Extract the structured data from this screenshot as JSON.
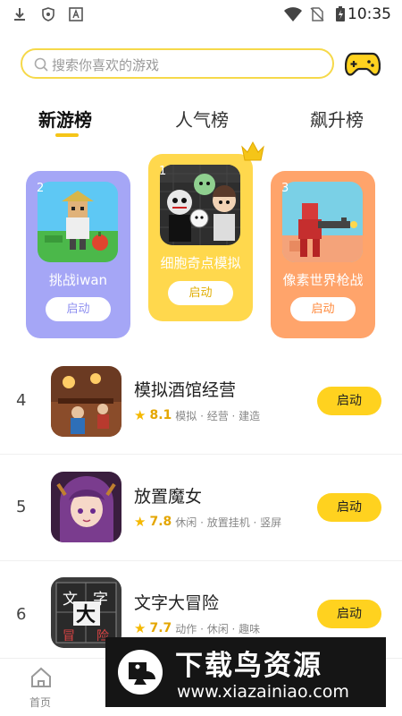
{
  "status_bar": {
    "time": "10:35",
    "icons": [
      "download-icon",
      "shield-icon",
      "text-a-icon",
      "wifi-icon",
      "no-sim-icon",
      "battery-charging-icon"
    ]
  },
  "search": {
    "placeholder": "搜索你喜欢的游戏"
  },
  "tabs": [
    {
      "label": "新游榜",
      "active": true
    },
    {
      "label": "人气榜",
      "active": false
    },
    {
      "label": "飙升榜",
      "active": false
    }
  ],
  "top_cards": [
    {
      "rank": "2",
      "name": "挑战iwan",
      "button": "启动",
      "color": "#a5a6f6",
      "button_text_color": "#8e8ff0"
    },
    {
      "rank": "1",
      "name": "细胞奇点模拟",
      "button": "启动",
      "color": "#ffd84d",
      "button_text_color": "#e0ad00"
    },
    {
      "rank": "3",
      "name": "像素世界枪战",
      "button": "启动",
      "color": "#ffa46b",
      "button_text_color": "#ff8a3d"
    }
  ],
  "list": [
    {
      "rank": "4",
      "title": "模拟酒馆经营",
      "score": "8.1",
      "tags": "模拟 · 经营 · 建造",
      "button": "启动"
    },
    {
      "rank": "5",
      "title": "放置魔女",
      "score": "7.8",
      "tags": "休闲 · 放置挂机 · 竖屏",
      "button": "启动"
    },
    {
      "rank": "6",
      "title": "文字大冒险",
      "score": "7.7",
      "tags": "动作 · 休闲 · 趣味",
      "button": "启动"
    }
  ],
  "bottom_nav": {
    "home_label": "首页"
  },
  "watermark": {
    "title": "下载鸟资源",
    "url": "www.xiazainiao.com"
  },
  "colors": {
    "accent": "#ffd21f",
    "search_border": "#f6d94a",
    "star": "#f5b800"
  }
}
